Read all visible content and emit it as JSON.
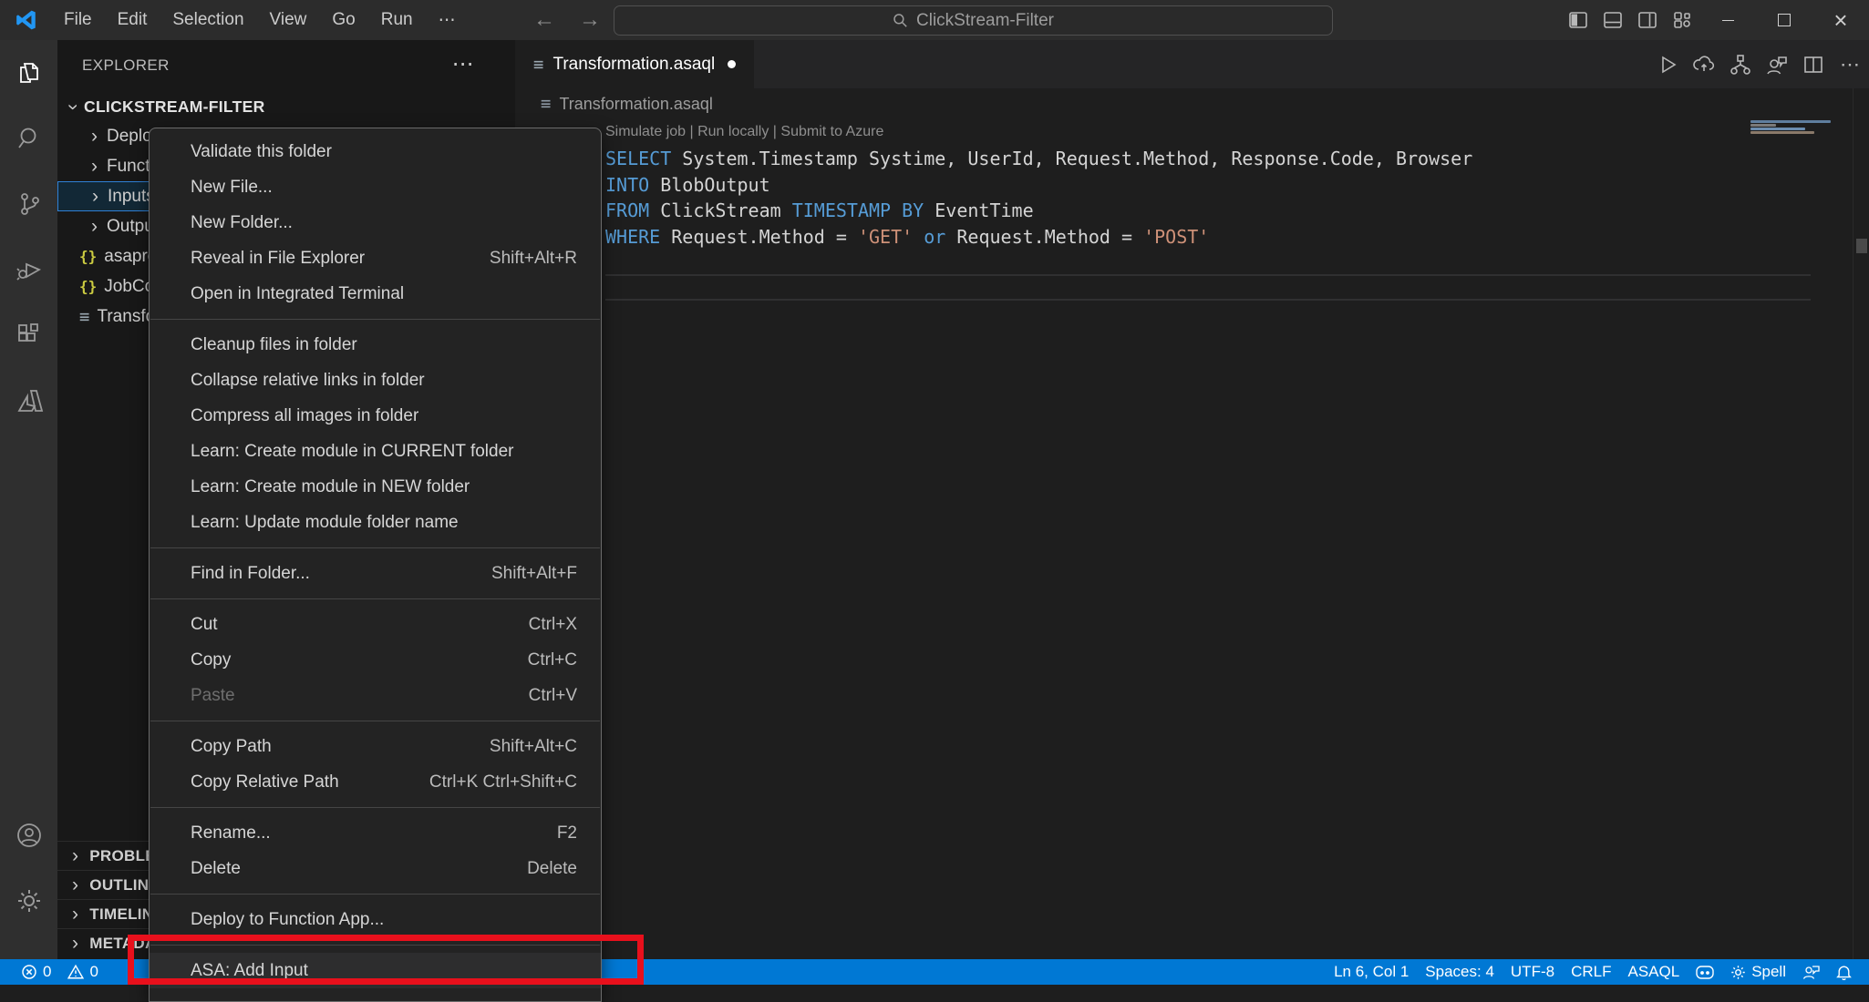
{
  "title_bar": {
    "menus": [
      "File",
      "Edit",
      "Selection",
      "View",
      "Go",
      "Run",
      "⋯"
    ],
    "search": {
      "value": "ClickStream-Filter"
    },
    "window_icons": [
      "toggle-sidebar",
      "toggle-panel",
      "toggle-secondary-sidebar",
      "customize-layout",
      "minimize",
      "maximize",
      "close"
    ]
  },
  "activity_bar": {
    "items": [
      "explorer",
      "search",
      "source-control",
      "run-and-debug",
      "extensions",
      "azure"
    ],
    "active": "explorer",
    "bottom": [
      "accounts",
      "settings"
    ]
  },
  "sidebar": {
    "header": "EXPLORER",
    "more_label": "⋯",
    "root": "CLICKSTREAM-FILTER",
    "tree": [
      {
        "icon": "chevron",
        "label": "Deployments",
        "selected": false
      },
      {
        "icon": "chevron",
        "label": "Functions",
        "selected": false
      },
      {
        "icon": "chevron",
        "label": "Inputs",
        "selected": true
      },
      {
        "icon": "chevron",
        "label": "Outputs",
        "selected": false
      },
      {
        "icon": "json",
        "label": "asaproj.json",
        "selected": false
      },
      {
        "icon": "json",
        "label": "JobConfig.json",
        "selected": false
      },
      {
        "icon": "lines",
        "label": "Transformation.asaql",
        "selected": false
      }
    ],
    "sections": [
      "PROBLEMS",
      "OUTLINE",
      "TIMELINE",
      "METADATA"
    ]
  },
  "context_menu": {
    "groups": [
      [
        {
          "label": "Validate this folder"
        },
        {
          "label": "New File..."
        },
        {
          "label": "New Folder..."
        },
        {
          "label": "Reveal in File Explorer",
          "shortcut": "Shift+Alt+R"
        },
        {
          "label": "Open in Integrated Terminal"
        }
      ],
      [
        {
          "label": "Cleanup files in folder"
        },
        {
          "label": "Collapse relative links in folder"
        },
        {
          "label": "Compress all images in folder"
        },
        {
          "label": "Learn: Create module in CURRENT folder"
        },
        {
          "label": "Learn: Create module in NEW folder"
        },
        {
          "label": "Learn: Update module folder name"
        }
      ],
      [
        {
          "label": "Find in Folder...",
          "shortcut": "Shift+Alt+F"
        }
      ],
      [
        {
          "label": "Cut",
          "shortcut": "Ctrl+X"
        },
        {
          "label": "Copy",
          "shortcut": "Ctrl+C"
        },
        {
          "label": "Paste",
          "shortcut": "Ctrl+V",
          "disabled": true
        }
      ],
      [
        {
          "label": "Copy Path",
          "shortcut": "Shift+Alt+C"
        },
        {
          "label": "Copy Relative Path",
          "shortcut": "Ctrl+K Ctrl+Shift+C"
        }
      ],
      [
        {
          "label": "Rename...",
          "shortcut": "F2"
        },
        {
          "label": "Delete",
          "shortcut": "Delete"
        }
      ],
      [
        {
          "label": "Deploy to Function App..."
        }
      ],
      [
        {
          "label": "ASA: Add Input",
          "highlighted": true
        }
      ]
    ]
  },
  "editor": {
    "tab": {
      "label": "Transformation.asaql",
      "modified": true
    },
    "breadcrumb": "Transformation.asaql",
    "codelens": "Simulate job | Run locally | Submit to Azure",
    "code_lines": [
      [
        {
          "t": "SELECT",
          "c": "kw"
        },
        {
          "t": " System.Timestamp Systime, UserId, Request.Method, Response.Code, Browser",
          "c": "id"
        }
      ],
      [
        {
          "t": "INTO",
          "c": "kw"
        },
        {
          "t": " BlobOutput",
          "c": "id"
        }
      ],
      [
        {
          "t": "FROM",
          "c": "kw"
        },
        {
          "t": " ClickStream ",
          "c": "id"
        },
        {
          "t": "TIMESTAMP BY",
          "c": "kw"
        },
        {
          "t": " EventTime",
          "c": "id"
        }
      ],
      [
        {
          "t": "WHERE",
          "c": "kw"
        },
        {
          "t": " Request.Method = ",
          "c": "id"
        },
        {
          "t": "'GET'",
          "c": "str"
        },
        {
          "t": " ",
          "c": "id"
        },
        {
          "t": "or",
          "c": "kw"
        },
        {
          "t": " Request.Method = ",
          "c": "id"
        },
        {
          "t": "'POST'",
          "c": "str"
        }
      ]
    ],
    "syntax_colors": {
      "keyword": "#569cd6",
      "identifier": "#d4d4d4",
      "string": "#ce9178",
      "codelens": "#8f8f8f"
    }
  },
  "status_bar": {
    "background": "#0078d4",
    "left": [
      {
        "icon": "error",
        "text": "0"
      },
      {
        "icon": "warning",
        "text": "0"
      }
    ],
    "right": [
      {
        "text": "Ln 6, Col 1"
      },
      {
        "text": "Spaces: 4"
      },
      {
        "text": "UTF-8"
      },
      {
        "text": "CRLF"
      },
      {
        "text": "ASAQL"
      },
      {
        "icon": "copilot"
      },
      {
        "icon": "gear",
        "text": "Spell"
      },
      {
        "icon": "person-feedback"
      },
      {
        "icon": "bell"
      }
    ]
  },
  "annotation": {
    "shape": "rectangle",
    "color": "#e8101c",
    "target": "ASA: Add Input"
  }
}
